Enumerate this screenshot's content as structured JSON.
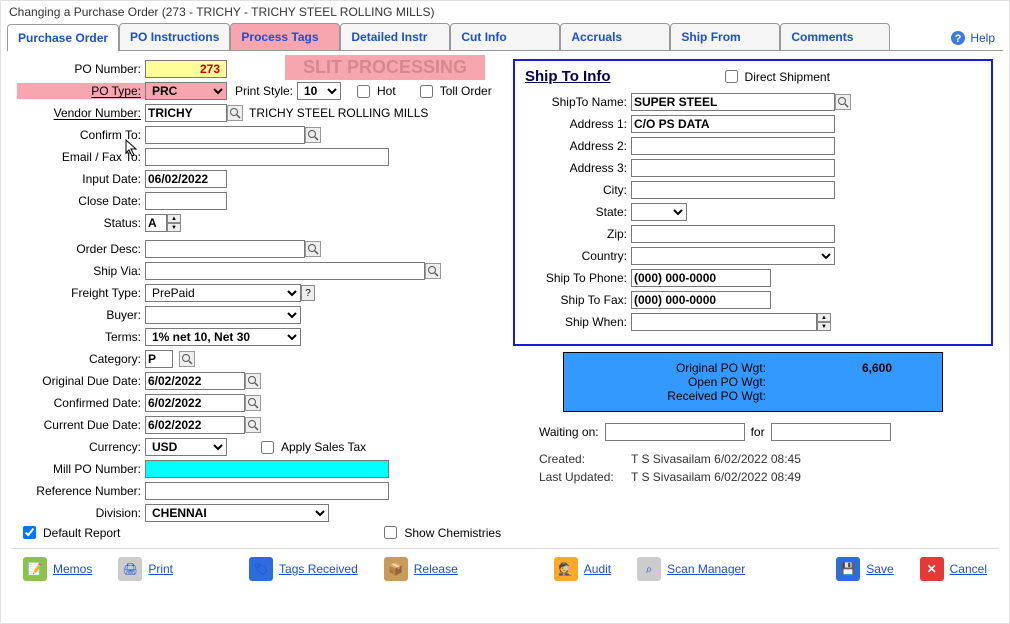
{
  "window": {
    "title": "Changing a Purchase Order  (273 - TRICHY - TRICHY STEEL ROLLING MILLS)"
  },
  "tabs": [
    "Purchase Order",
    "PO Instructions",
    "Process Tags",
    "Detailed Instr",
    "Cut Info",
    "Accruals",
    "Ship From",
    "Comments"
  ],
  "help": "Help",
  "watermark": "SLIT PROCESSING",
  "left": {
    "po_number_label": "PO Number:",
    "po_number": "273",
    "po_type_label": "PO Type:",
    "po_type": "PRC",
    "print_style_label": "Print Style:",
    "print_style": "10",
    "hot_label": "Hot",
    "toll_order_label": "Toll Order",
    "vendor_number_label": "Vendor Number:",
    "vendor_number": "TRICHY",
    "vendor_name": "TRICHY STEEL ROLLING MILLS",
    "confirm_to_label": "Confirm To:",
    "confirm_to": "",
    "email_fax_label": "Email / Fax To:",
    "email_fax": "",
    "input_date_label": "Input Date:",
    "input_date": "06/02/2022",
    "close_date_label": "Close Date:",
    "close_date": "",
    "status_label": "Status:",
    "status": "A",
    "order_desc_label": "Order Desc:",
    "order_desc": "",
    "ship_via_label": "Ship Via:",
    "ship_via": "",
    "freight_type_label": "Freight Type:",
    "freight_type": "PrePaid",
    "buyer_label": "Buyer:",
    "buyer": "",
    "terms_label": "Terms:",
    "terms": "1% net 10, Net 30",
    "category_label": "Category:",
    "category": "P",
    "orig_due_label": "Original Due Date:",
    "orig_due": "6/02/2022",
    "conf_date_label": "Confirmed Date:",
    "conf_date": "6/02/2022",
    "curr_due_label": "Current Due Date:",
    "curr_due": "6/02/2022",
    "currency_label": "Currency:",
    "currency": "USD",
    "apply_tax_label": "Apply Sales Tax",
    "mill_po_label": "Mill PO Number:",
    "mill_po": "",
    "ref_num_label": "Reference Number:",
    "ref_num": "",
    "division_label": "Division:",
    "division": "CHENNAI"
  },
  "shipto": {
    "title": "Ship To Info",
    "direct_label": "Direct Shipment",
    "name_label": "ShipTo Name:",
    "name": "SUPER STEEL",
    "addr1_label": "Address 1:",
    "addr1": "C/O PS DATA",
    "addr2_label": "Address 2:",
    "addr2": "",
    "addr3_label": "Address 3:",
    "addr3": "",
    "city_label": "City:",
    "city": "",
    "state_label": "State:",
    "state": "",
    "zip_label": "Zip:",
    "zip": "",
    "country_label": "Country:",
    "country": "",
    "phone_label": "Ship To Phone:",
    "phone": "(000) 000-0000",
    "fax_label": "Ship To Fax:",
    "fax": "(000) 000-0000",
    "ship_when_label": "Ship When:",
    "ship_when": ""
  },
  "wgt": {
    "orig_label": "Original PO Wgt:",
    "orig": "6,600",
    "open_label": "Open PO Wgt:",
    "open": "",
    "recv_label": "Received PO Wgt:",
    "recv": ""
  },
  "waiting": {
    "label": "Waiting on:",
    "for": "for"
  },
  "meta": {
    "created_label": "Created:",
    "created": "T S Sivasailam 6/02/2022 08:45",
    "updated_label": "Last Updated:",
    "updated": "T S Sivasailam 6/02/2022 08:49"
  },
  "footer": {
    "default_report": "Default Report",
    "show_chem": "Show Chemistries",
    "memos": "Memos",
    "print": "Print",
    "tags_recv": "Tags Received",
    "release": "Release",
    "audit": "Audit",
    "scan_mgr": "Scan Manager",
    "save": "Save",
    "cancel": "Cancel"
  }
}
